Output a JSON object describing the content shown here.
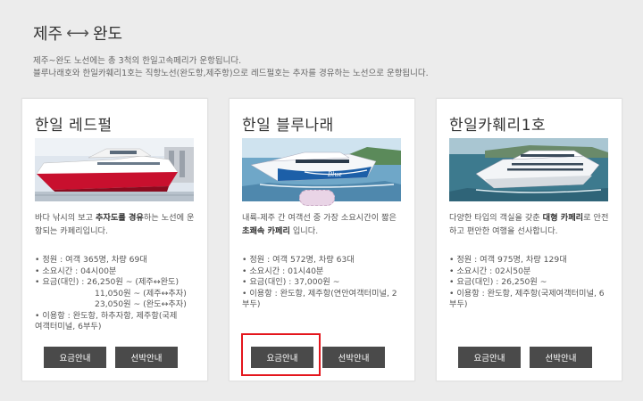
{
  "header": {
    "title_from": "제주",
    "title_arrow": "⟷",
    "title_to": "완도",
    "desc_line1": "제주~완도 노선에는 총 3척의 한일고속페리가 운항됩니다.",
    "desc_line2": "블루나래호와 한일카훼리1호는 직항노선(완도항,제주항)으로 레드펄호는 추자를 경유하는 노선으로 운항됩니다."
  },
  "ships": [
    {
      "name": "한일 레드펄",
      "summary_a": "바다 낚시의 보고 ",
      "summary_bold": "추자도를 경유",
      "summary_b": "하는 노선에 운항되는 카페리입니다.",
      "capacity": "• 정원 : 여객 365명, 차량 69대",
      "duration": "• 소요시간 : 04시00분",
      "fare1": "• 요금(대인) : 26,250원 ~ (제주↔완도)",
      "fare2": "11,050원 ~ (제주↔추자)",
      "fare3": "23,050원 ~ (완도↔추자)",
      "port": "• 이용항 : 완도항, 하추자항, 제주항(국제여객터미널, 6부두)",
      "fare_button": "요금안내",
      "berth_button": "선박안내"
    },
    {
      "name": "한일 블루나래",
      "summary_a": "내륙-제주 간 여객선 중 가장 소요시간이 짧은 ",
      "summary_bold": "초쾌속 카페리",
      "summary_b": " 입니다.",
      "capacity": "• 정원 : 여객 572명, 차량 63대",
      "duration": "• 소요시간 : 01시40분",
      "fare1": "• 요금(대인) : 37,000원 ~",
      "port": "• 이용항 : 완도항, 제주항(연안여객터미널, 2부두)",
      "fare_button": "요금안내",
      "berth_button": "선박안내"
    },
    {
      "name": "한일카훼리1호",
      "summary_a": "다양한 타입의 객실을 갖춘 ",
      "summary_bold": "대형 카페리",
      "summary_b": "로 안전하고 편안한 여행을 선사합니다.",
      "capacity": "• 정원 : 여객 975명, 차량 129대",
      "duration": "• 소요시간 : 02시50분",
      "fare1": "• 요금(대인) : 26,250원 ~",
      "port": "• 이용항 : 완도항, 제주항(국제여객터미널, 6부두)",
      "fare_button": "요금안내",
      "berth_button": "선박안내"
    }
  ],
  "colors": {
    "button_bg": "#4a4a4a",
    "highlight": "#e4161d",
    "red_hull": "#c8102e"
  }
}
